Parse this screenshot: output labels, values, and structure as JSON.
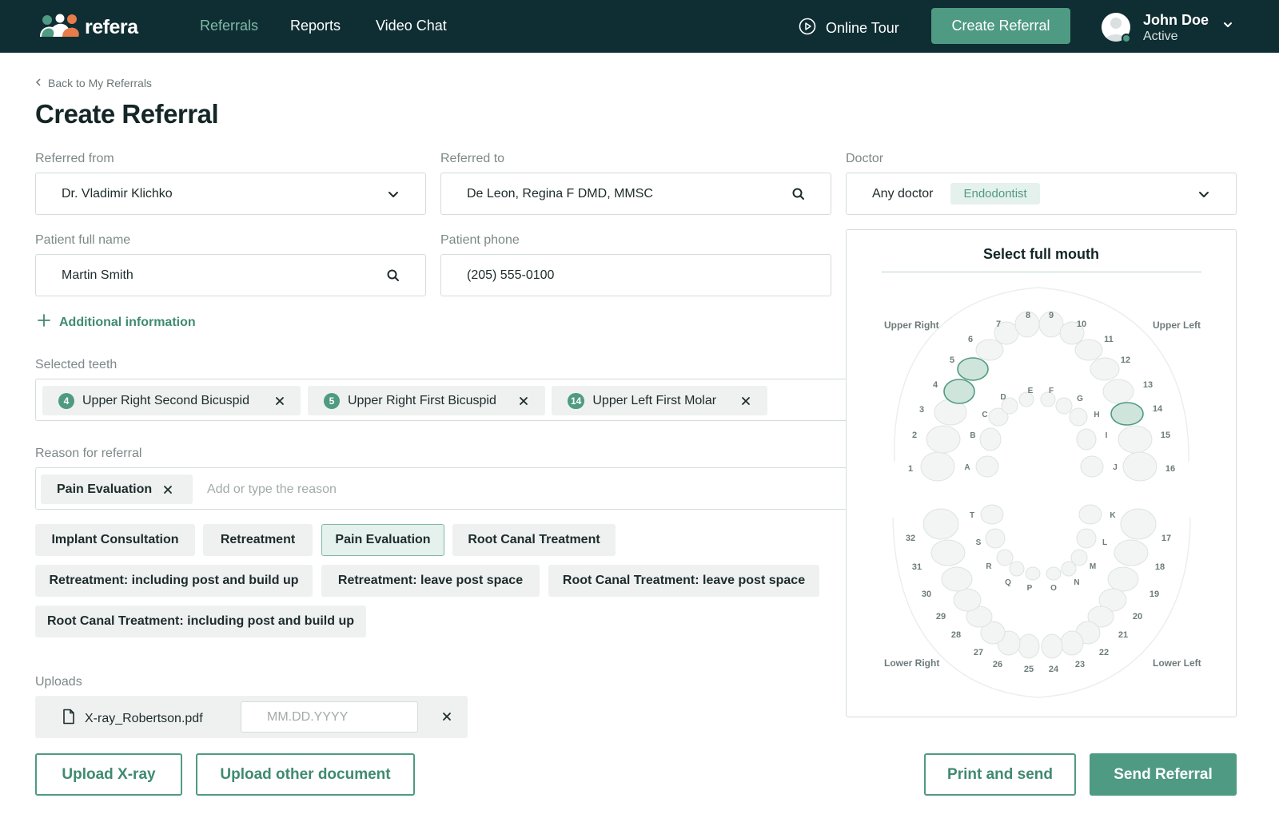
{
  "app": {
    "name": "refera"
  },
  "nav": {
    "links": [
      "Referrals",
      "Reports",
      "Video Chat"
    ],
    "tour": "Online Tour",
    "create_button": "Create Referral"
  },
  "user": {
    "name": "John Doe",
    "status": "Active"
  },
  "page": {
    "back": "Back to My Referrals",
    "title": "Create Referral"
  },
  "form": {
    "referred_from": {
      "label": "Referred from",
      "value": "Dr. Vladimir Klichko"
    },
    "referred_to": {
      "label": "Referred to",
      "value": "De Leon, Regina F DMD, MMSC"
    },
    "doctor": {
      "label": "Doctor",
      "value": "Any doctor",
      "tag": "Endodontist"
    },
    "patient_name": {
      "label": "Patient full name",
      "value": "Martin Smith"
    },
    "patient_phone": {
      "label": "Patient phone",
      "value": "(205) 555-0100"
    },
    "additional_info": "Additional information",
    "selected_teeth": {
      "label": "Selected teeth",
      "chips": [
        {
          "number": "4",
          "name": "Upper Right Second Bicuspid"
        },
        {
          "number": "5",
          "name": "Upper Right First Bicuspid"
        },
        {
          "number": "14",
          "name": "Upper Left First Molar"
        }
      ]
    },
    "reason": {
      "label": "Reason for referral",
      "chip": "Pain Evaluation",
      "placeholder": "Add or type the reason"
    },
    "reason_options": [
      "Implant Consultation",
      "Retreatment",
      "Pain Evaluation",
      "Root Canal Treatment",
      "Retreatment: including post and build up",
      "Retreatment: leave post space",
      "Root Canal Treatment: leave post space",
      "Root Canal Treatment: including post and build up"
    ],
    "selected_reason": "Pain Evaluation",
    "uploads": {
      "label": "Uploads",
      "file_name": "X-ray_Robertson.pdf",
      "date_placeholder": "MM.DD.YYYY"
    }
  },
  "buttons": {
    "upload_xray": "Upload X-ray",
    "upload_other": "Upload other document",
    "print_send": "Print and send",
    "send": "Send Referral"
  },
  "tooth_chart": {
    "title": "Select full mouth",
    "quadrants": [
      "Upper Right",
      "Upper Left",
      "Lower Right",
      "Lower Left"
    ],
    "selected_teeth": [
      4,
      5,
      14
    ],
    "accent_color": "#4f9a82"
  },
  "icons": [
    "logo-icon",
    "play-circle-icon",
    "avatar",
    "chevron-down-icon",
    "chevron-left-icon",
    "search-icon",
    "plus-icon",
    "close-icon",
    "file-icon"
  ]
}
